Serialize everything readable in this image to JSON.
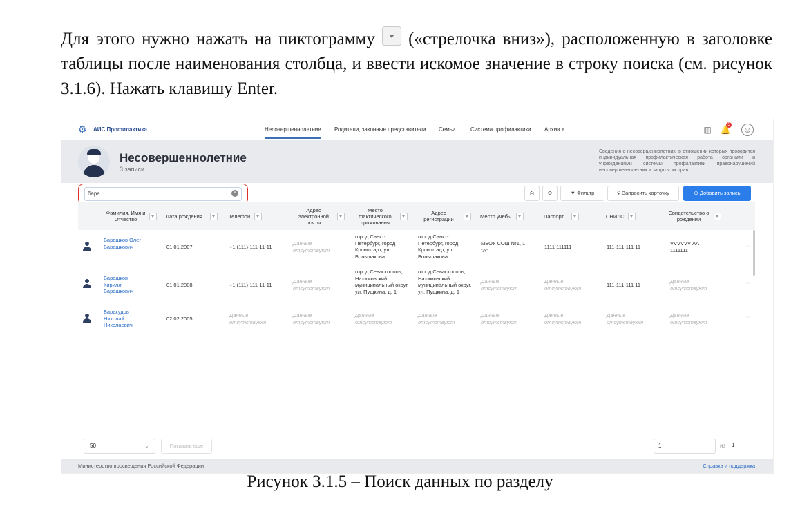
{
  "document": {
    "paragraph_part1": "Для этого нужно нажать на пиктограмму",
    "paragraph_part2": "(«стрелочка вниз»), расположенную в заголовке таблицы после наименования столбца, и ввести искомое значение в строку поиска (см. рисунок 3.1.6). Нажать клавишу Enter.",
    "caption": "Рисунок 3.1.5 – Поиск данных по разделу"
  },
  "app": {
    "logo": "АИС Профилактика",
    "nav": [
      "Несовершеннолетние",
      "Родители, законные представители",
      "Семьи",
      "Система профилактики",
      "Архив"
    ],
    "notification_count": "5"
  },
  "page": {
    "title": "Несовершеннолетние",
    "subtitle": "3 записи",
    "description": "Сведения о несовершеннолетних, в отношении которых проводится индивидуальная профилактическая работа органами и учреждениями системы профилактики правонарушений несовершеннолетних и защиты их прав"
  },
  "toolbar": {
    "search_value": "бара",
    "filter_label": "Фильтр",
    "request_card_label": "Запросить карточку",
    "add_label": "Добавить запись"
  },
  "table": {
    "columns": [
      "Фамилия, Имя и Отчество",
      "Дата рождения",
      "Телефон",
      "Адрес электронной почты",
      "Место фактического проживания",
      "Адрес регистрации",
      "Место учебы",
      "Паспорт",
      "СНИЛС",
      "Свидетельство о рождении"
    ],
    "rows": [
      {
        "name": "Барашков Олег Барашкович",
        "birth": "01.01.2007",
        "phone": "+1 (111)-111-11-11",
        "email": "Данные отсутствуют",
        "residence": "город Санкт-Петербург, город Кронштадт, ул. Большакова",
        "registration": "город Санкт-Петербург, город Кронштадт, ул. Большакова",
        "school": "МБОУ СОШ №1, 1 \"А\"",
        "passport": "1111 111111",
        "snils": "111-111-111 11",
        "certificate": "VVVVVV АА 1111111"
      },
      {
        "name": "Барашков Кирилл Барашкович",
        "birth": "01.01.2008",
        "phone": "+1 (111)-111-11-11",
        "email": "Данные отсутствуют",
        "residence": "город Севастополь, Нахимовский муниципальный округ, ул. Пущкина, д. 1",
        "registration": "город Севастополь, Нахимовский муниципальный округ, ул. Пущкина, д. 1",
        "school": "Данные отсутствуют",
        "passport": "Данные отсутствуют",
        "snils": "111-111-111 11",
        "certificate": "Данные отсутствуют"
      },
      {
        "name": "Баракудов Николай Николаевич",
        "birth": "02.02.2005",
        "phone": "Данные отсутствуют",
        "email": "Данные отсутствуют",
        "residence": "Данные отсутствуют",
        "registration": "Данные отсутствуют",
        "school": "Данные отсутствуют",
        "passport": "Данные отсутствуют",
        "snils": "Данные отсутствуют",
        "certificate": "Данные отсутствуют"
      }
    ]
  },
  "pager": {
    "page_size": "50",
    "show_more": "Показать еще",
    "page_input": "1",
    "of_label": "из",
    "total_pages": "1"
  },
  "footer": {
    "left": "Министерство просвещения Российской Федерации",
    "right": "Справка и поддержка"
  }
}
